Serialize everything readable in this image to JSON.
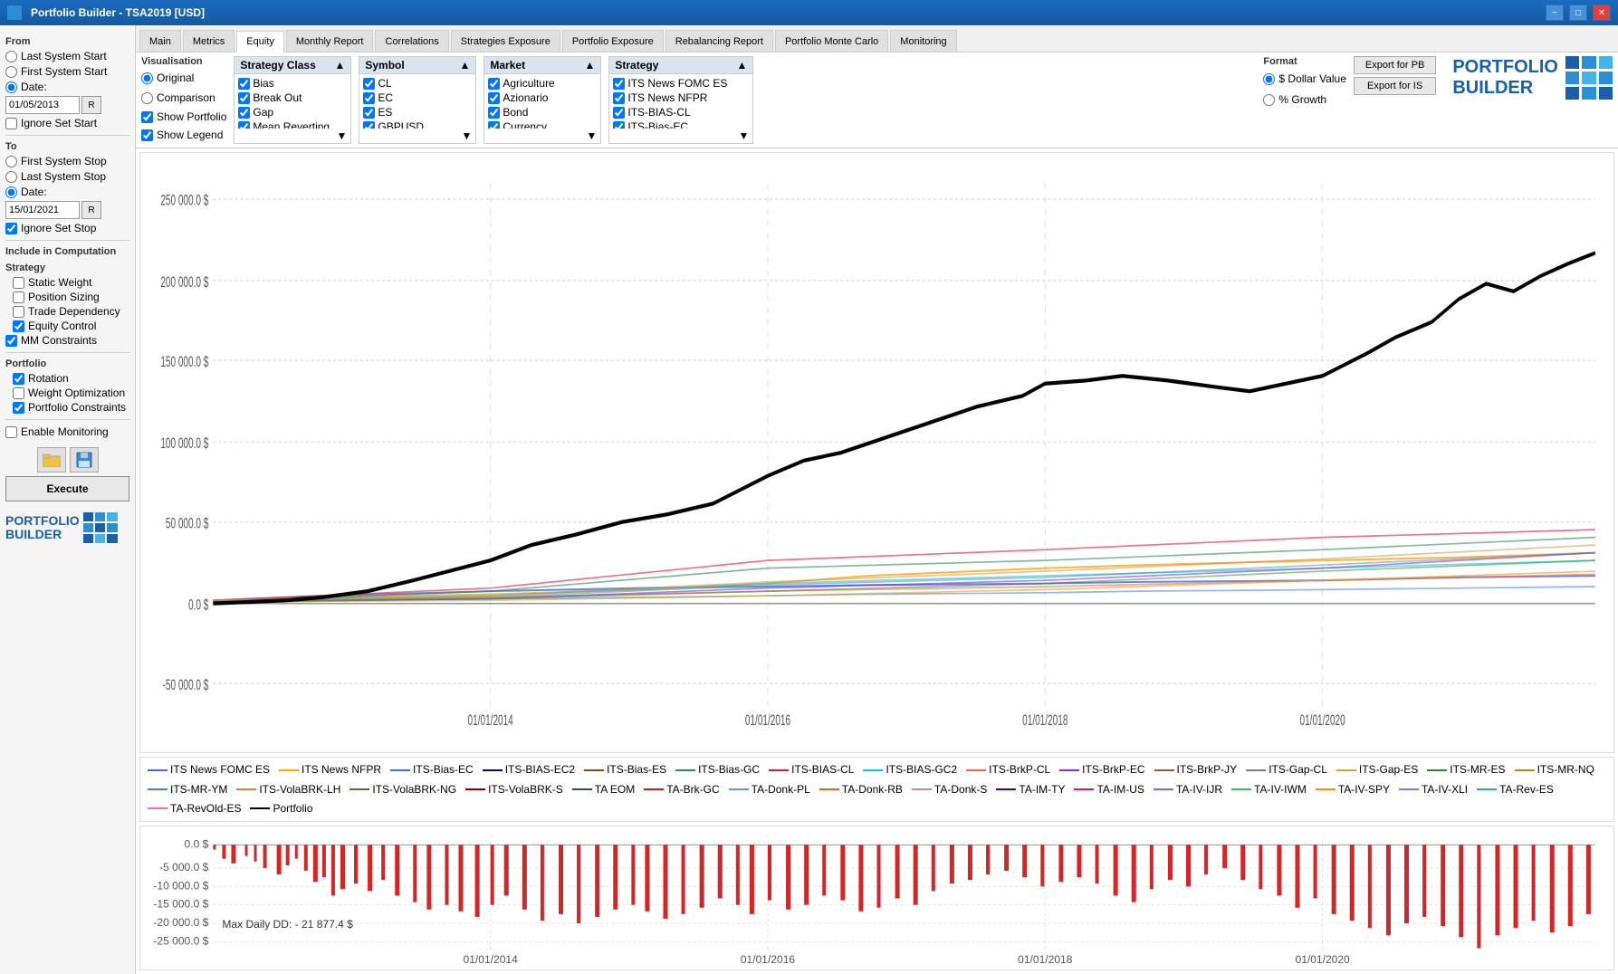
{
  "titlebar": {
    "title": "Portfolio Builder - TSA2019 [USD]",
    "min_btn": "−",
    "max_btn": "□",
    "close_btn": "✕"
  },
  "sidebar": {
    "from_label": "From",
    "from_options": [
      {
        "id": "last_sys_start",
        "label": "Last System Start",
        "checked": false
      },
      {
        "id": "first_sys_start",
        "label": "First System Start",
        "checked": false
      },
      {
        "id": "date_from",
        "label": "Date:",
        "checked": true
      }
    ],
    "from_date": "01/05/2013",
    "ignore_set_start": {
      "label": "Ignore Set Start",
      "checked": false
    },
    "to_label": "To",
    "to_options": [
      {
        "id": "first_sys_stop",
        "label": "First System Stop",
        "checked": false
      },
      {
        "id": "last_sys_stop",
        "label": "Last System Stop",
        "checked": false
      },
      {
        "id": "date_to",
        "label": "Date:",
        "checked": true
      }
    ],
    "to_date": "15/01/2021",
    "ignore_set_stop": {
      "label": "Ignore Set Stop",
      "checked": true
    },
    "include_label": "Include in Computation",
    "strategy_label": "Strategy",
    "strategy_items": [
      {
        "label": "Static Weight",
        "checked": false
      },
      {
        "label": "Position Sizing",
        "checked": false
      },
      {
        "label": "Trade Dependency",
        "checked": false
      },
      {
        "label": "Equity Control",
        "checked": true
      }
    ],
    "mm_constraints": {
      "label": "MM Constraints",
      "checked": true
    },
    "portfolio_label": "Portfolio",
    "portfolio_items": [
      {
        "label": "Rotation",
        "checked": true
      },
      {
        "label": "Weight Optimization",
        "checked": false
      },
      {
        "label": "Portfolio Constraints",
        "checked": true
      }
    ],
    "enable_monitoring": {
      "label": "Enable Monitoring",
      "checked": false
    },
    "execute_label": "Execute"
  },
  "tabs": [
    {
      "label": "Main",
      "active": false
    },
    {
      "label": "Metrics",
      "active": false
    },
    {
      "label": "Equity",
      "active": true
    },
    {
      "label": "Monthly Report",
      "active": false
    },
    {
      "label": "Correlations",
      "active": false
    },
    {
      "label": "Strategies Exposure",
      "active": false
    },
    {
      "label": "Portfolio Exposure",
      "active": false
    },
    {
      "label": "Rebalancing Report",
      "active": false
    },
    {
      "label": "Portfolio Monte Carlo",
      "active": false
    },
    {
      "label": "Monitoring",
      "active": false
    }
  ],
  "visualization": {
    "label": "Visualisation",
    "viz_options": [
      {
        "id": "original",
        "label": "Original",
        "checked": true
      },
      {
        "id": "comparison",
        "label": "Comparison",
        "checked": false
      }
    ],
    "show_portfolio": {
      "label": "Show Portfolio",
      "checked": true
    },
    "show_legend": {
      "label": "Show Legend",
      "checked": true
    }
  },
  "strategy_class": {
    "label": "Strategy Class",
    "items": [
      {
        "label": "Bias",
        "checked": true
      },
      {
        "label": "Break Out",
        "checked": true
      },
      {
        "label": "Gap",
        "checked": true
      },
      {
        "label": "Mean Reverting",
        "checked": true
      }
    ]
  },
  "symbol": {
    "label": "Symbol",
    "items": [
      {
        "label": "CL",
        "checked": true
      },
      {
        "label": "EC",
        "checked": true
      },
      {
        "label": "ES",
        "checked": true
      },
      {
        "label": "GBPUSD",
        "checked": true
      }
    ]
  },
  "market": {
    "label": "Market",
    "items": [
      {
        "label": "Agriculture",
        "checked": true
      },
      {
        "label": "Azionario",
        "checked": true
      },
      {
        "label": "Bond",
        "checked": true
      },
      {
        "label": "Currency",
        "checked": true
      }
    ]
  },
  "strategy_filter": {
    "label": "Strategy",
    "items": [
      {
        "label": "ITS News FOMC ES",
        "checked": true
      },
      {
        "label": "ITS News NFPR",
        "checked": true
      },
      {
        "label": "ITS-BIAS-CL",
        "checked": true
      },
      {
        "label": "ITS-Bias-EC",
        "checked": true
      }
    ]
  },
  "format": {
    "label": "Format",
    "options": [
      {
        "id": "dollar",
        "label": "$ Dollar Value",
        "checked": true
      },
      {
        "id": "growth",
        "label": "% Growth",
        "checked": false
      }
    ]
  },
  "export": {
    "export_pb": "Export for PB",
    "export_is": "Export for IS"
  },
  "chart": {
    "y_labels": [
      "250 000.0 $",
      "200 000.0 $",
      "150 000.0 $",
      "100 000.0 $",
      "50 000.0 $",
      "0.0 $",
      "-50 000.0 $"
    ],
    "x_labels": [
      "01/01/2014",
      "01/01/2016",
      "01/01/2018",
      "01/01/2020"
    ]
  },
  "dd_chart": {
    "y_labels": [
      "0.0 $",
      "-5 000.0 $",
      "-10 000.0 $",
      "-15 000.0 $",
      "-20 000.0 $",
      "-25 000.0 $"
    ],
    "x_labels": [
      "01/01/2014",
      "01/01/2016",
      "01/01/2018",
      "01/01/2020"
    ],
    "max_dd_label": "Max Daily DD: - 21 877.4 $"
  },
  "legend": {
    "items": [
      {
        "label": "ITS News FOMC ES",
        "color": "#4169e1"
      },
      {
        "label": "ITS News NFPR",
        "color": "#ffa500"
      },
      {
        "label": "ITS-Bias-EC",
        "color": "#4169e1"
      },
      {
        "label": "ITS-BIAS-EC2",
        "color": "#000080"
      },
      {
        "label": "ITS-Bias-ES",
        "color": "#8b4513"
      },
      {
        "label": "ITS-Bias-GC",
        "color": "#2e8b57"
      },
      {
        "label": "ITS-BIAS-CL",
        "color": "#dc143c"
      },
      {
        "label": "ITS-BIAS-GC2",
        "color": "#00ced1"
      },
      {
        "label": "ITS-BrkP-CL",
        "color": "#ff6347"
      },
      {
        "label": "ITS-BrkP-EC",
        "color": "#8a2be2"
      },
      {
        "label": "ITS-BrkP-JY",
        "color": "#a0522d"
      },
      {
        "label": "ITS-Gap-CL",
        "color": "#708090"
      },
      {
        "label": "ITS-Gap-ES",
        "color": "#daa520"
      },
      {
        "label": "ITS-MR-ES",
        "color": "#228b22"
      },
      {
        "label": "ITS-MR-NQ",
        "color": "#b8860b"
      },
      {
        "label": "ITS-MR-YM",
        "color": "#4682b4"
      },
      {
        "label": "ITS-VolaBRK-LH",
        "color": "#cd853f"
      },
      {
        "label": "ITS-VolaBRK-NG",
        "color": "#556b2f"
      },
      {
        "label": "ITS-VolaBRK-S",
        "color": "#8b0000"
      },
      {
        "label": "TA EOM",
        "color": "#2f4f4f"
      },
      {
        "label": "TA-Brk-GC",
        "color": "#b22222"
      },
      {
        "label": "TA-Donk-PL",
        "color": "#6495ed"
      },
      {
        "label": "TA-Donk-RB",
        "color": "#d2691e"
      },
      {
        "label": "TA-Donk-S",
        "color": "#bc8f8f"
      },
      {
        "label": "TA-IM-TY",
        "color": "#4b0082"
      },
      {
        "label": "TA-IM-US",
        "color": "#c71585"
      },
      {
        "label": "TA-IV-IJR",
        "color": "#7b68ee"
      },
      {
        "label": "TA-IV-IWM",
        "color": "#3cb371"
      },
      {
        "label": "TA-IV-SPY",
        "color": "#ff8c00"
      },
      {
        "label": "TA-IV-XLI",
        "color": "#9370db"
      },
      {
        "label": "TA-Rev-ES",
        "color": "#20b2aa"
      },
      {
        "label": "TA-RevOld-ES",
        "color": "#ff69b4"
      },
      {
        "label": "Portfolio",
        "color": "#000000"
      }
    ]
  }
}
